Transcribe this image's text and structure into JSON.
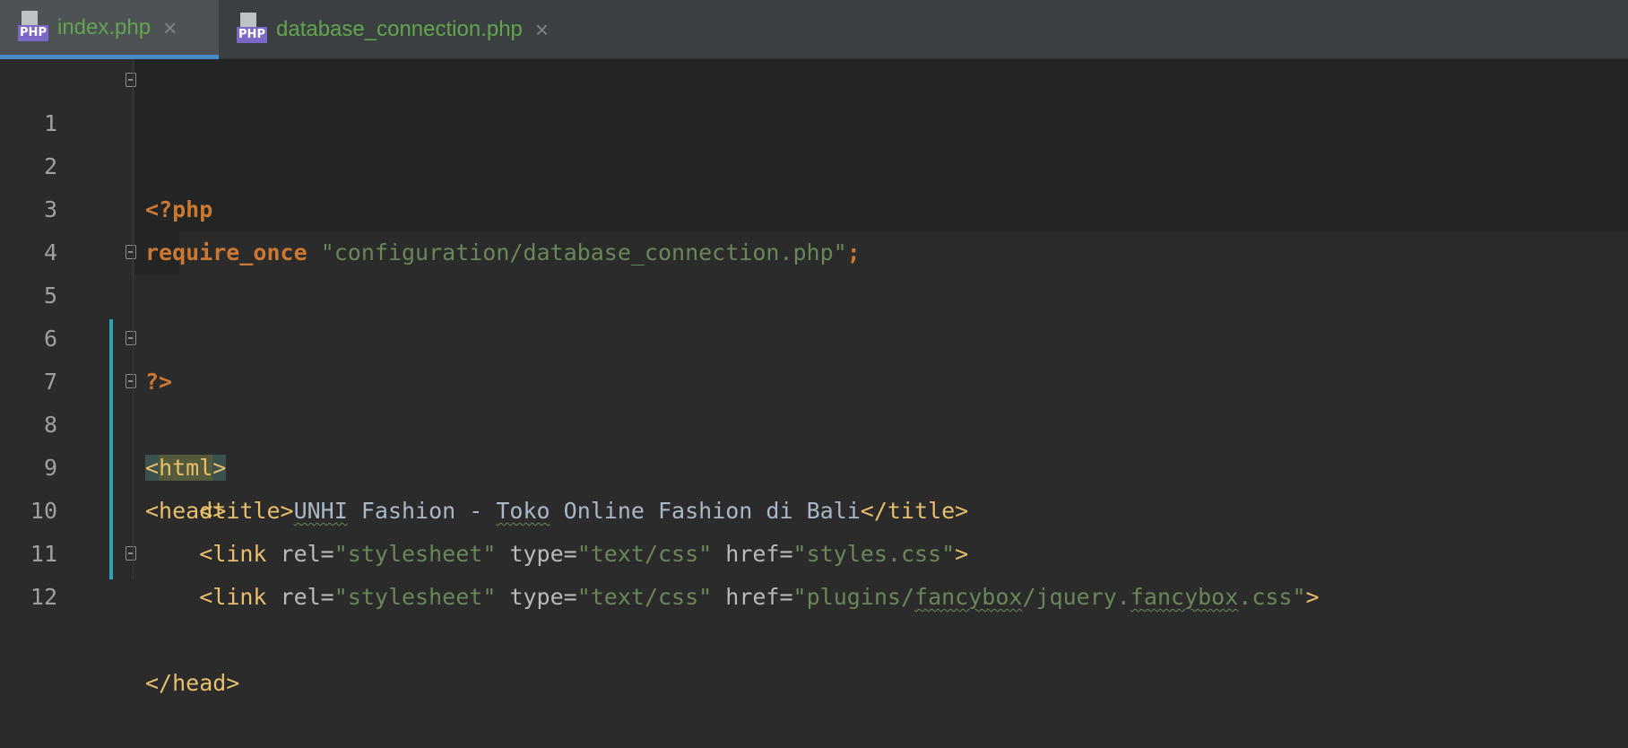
{
  "tabs": [
    {
      "label": "index.php",
      "icon": "php-file-icon",
      "badge": "PHP",
      "active": true,
      "close": "×"
    },
    {
      "label": "database_connection.php",
      "icon": "php-file-icon",
      "badge": "PHP",
      "active": false,
      "close": "×"
    }
  ],
  "colors": {
    "background": "#2b2b2b",
    "keyword": "#cc7832",
    "string": "#6a8759",
    "tag": "#e8bf6a",
    "attribute": "#bababa",
    "text": "#a9b7c6",
    "line_number": "#a0a0a0",
    "active_tab_underline": "#4a88c7",
    "vcs_change_marker": "#2ba3b5"
  },
  "editor": {
    "lines": [
      {
        "number": "1",
        "tokens": [
          "<?php"
        ]
      },
      {
        "number": "2",
        "tokens": []
      },
      {
        "number": "3",
        "tokens": [
          "require_once",
          " ",
          "\"configuration/database_connection.php\"",
          ";"
        ]
      },
      {
        "number": "4",
        "tokens": []
      },
      {
        "number": "5",
        "tokens": [
          "?>"
        ]
      },
      {
        "number": "6",
        "tokens": []
      },
      {
        "number": "7",
        "tokens": [
          "<",
          "html",
          ">"
        ]
      },
      {
        "number": "8",
        "tokens": [
          "<head>"
        ]
      },
      {
        "number": "9",
        "tokens": [
          "    ",
          "<title>",
          "UNHI",
          " Fashion - ",
          "Toko",
          " Online Fashion di Bali",
          "</title>"
        ]
      },
      {
        "number": "10",
        "tokens": [
          "    ",
          "<link ",
          "rel=",
          "\"stylesheet\"",
          " ",
          "type=",
          "\"text/css\"",
          " ",
          "href=",
          "\"styles.css\"",
          ">"
        ]
      },
      {
        "number": "11",
        "tokens": [
          "    ",
          "<link ",
          "rel=",
          "\"stylesheet\"",
          " ",
          "type=",
          "\"text/css\"",
          " ",
          "href=",
          "\"plugins/",
          "fancybox",
          "/jquery.",
          "fancybox",
          ".css\"",
          ">"
        ]
      },
      {
        "number": "12",
        "tokens": [
          "</head>"
        ]
      }
    ]
  }
}
